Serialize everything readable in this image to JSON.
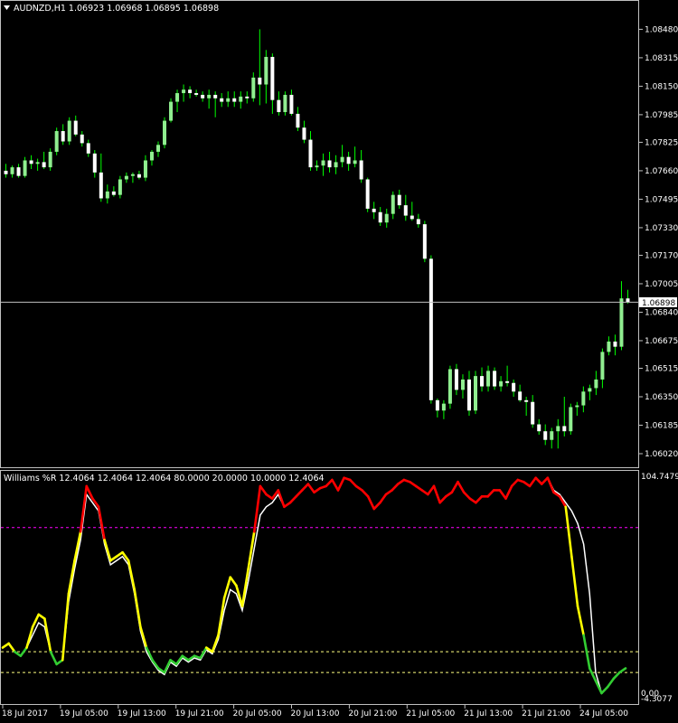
{
  "symbol_header": {
    "arrow_icon": "triangle-down-icon",
    "text": "AUDNZD,H1  1.06923 1.06968 1.06895 1.06898"
  },
  "indicator_header": {
    "text": "Williams %R 12.4064 12.4064 12.4064 80.0000 20.0000 10.0000 12.4064"
  },
  "colors": {
    "background": "#000000",
    "bull_candle": "#90ee90",
    "bear_candle": "#ffffff",
    "wick": "#00ff00",
    "price_line": "#c0c0c0",
    "wpr_main": "#ffff00",
    "wpr_overbought": "#ff0000",
    "wpr_oversold": "#32cd32",
    "wpr_signal": "#ffffff",
    "level_80": "#ff00ff",
    "level_20": "#ffff80"
  },
  "current_price_label": "1.06898",
  "chart_data": [
    {
      "type": "candlestick",
      "title": "AUDNZD,H1",
      "ylim": [
        1.0602,
        1.08545
      ],
      "y_ticks": [
        "1.08480",
        "1.08315",
        "1.08150",
        "1.07985",
        "1.07825",
        "1.07660",
        "1.07495",
        "1.07330",
        "1.07170",
        "1.07005",
        "1.06840",
        "1.06675",
        "1.06515",
        "1.06350",
        "1.06185",
        "1.06020"
      ],
      "last_price": 1.06898,
      "ohlc": [
        [
          1.0766,
          1.077,
          1.0762,
          1.0764
        ],
        [
          1.0764,
          1.0769,
          1.0762,
          1.0768
        ],
        [
          1.0768,
          1.077,
          1.0762,
          1.0763
        ],
        [
          1.0763,
          1.0774,
          1.0762,
          1.0772
        ],
        [
          1.0772,
          1.0775,
          1.0767,
          1.077
        ],
        [
          1.077,
          1.0773,
          1.0766,
          1.0771
        ],
        [
          1.0771,
          1.0777,
          1.0767,
          1.0768
        ],
        [
          1.0768,
          1.0779,
          1.0766,
          1.0777
        ],
        [
          1.0777,
          1.0791,
          1.0775,
          1.0789
        ],
        [
          1.0789,
          1.0793,
          1.0781,
          1.0783
        ],
        [
          1.0783,
          1.0797,
          1.0781,
          1.0795
        ],
        [
          1.0795,
          1.0798,
          1.0786,
          1.0787
        ],
        [
          1.0787,
          1.0789,
          1.078,
          1.0782
        ],
        [
          1.0782,
          1.0784,
          1.0774,
          1.0776
        ],
        [
          1.0776,
          1.0778,
          1.0762,
          1.0765
        ],
        [
          1.0765,
          1.0776,
          1.0748,
          1.075
        ],
        [
          1.075,
          1.0758,
          1.0747,
          1.0754
        ],
        [
          1.0754,
          1.0757,
          1.0751,
          1.0752
        ],
        [
          1.0752,
          1.0763,
          1.075,
          1.0761
        ],
        [
          1.0761,
          1.0765,
          1.0759,
          1.0763
        ],
        [
          1.0763,
          1.0765,
          1.0759,
          1.0764
        ],
        [
          1.0764,
          1.0766,
          1.0761,
          1.0762
        ],
        [
          1.0762,
          1.0775,
          1.076,
          1.0772
        ],
        [
          1.0772,
          1.0778,
          1.0769,
          1.0777
        ],
        [
          1.0777,
          1.0783,
          1.0774,
          1.0781
        ],
        [
          1.0781,
          1.0797,
          1.0779,
          1.0795
        ],
        [
          1.0795,
          1.0808,
          1.0794,
          1.0806
        ],
        [
          1.0806,
          1.0813,
          1.08,
          1.0811
        ],
        [
          1.0811,
          1.0816,
          1.0806,
          1.0813
        ],
        [
          1.0813,
          1.0815,
          1.0808,
          1.0811
        ],
        [
          1.0811,
          1.0813,
          1.0809,
          1.081
        ],
        [
          1.081,
          1.0812,
          1.0806,
          1.0808
        ],
        [
          1.0808,
          1.0813,
          1.0802,
          1.081
        ],
        [
          1.081,
          1.0812,
          1.0797,
          1.0808
        ],
        [
          1.0808,
          1.0811,
          1.0803,
          1.0806
        ],
        [
          1.0806,
          1.0812,
          1.0803,
          1.0808
        ],
        [
          1.0808,
          1.0812,
          1.0803,
          1.0806
        ],
        [
          1.0806,
          1.0812,
          1.0802,
          1.0809
        ],
        [
          1.0809,
          1.0812,
          1.0805,
          1.0808
        ],
        [
          1.0808,
          1.0823,
          1.0806,
          1.082
        ],
        [
          1.082,
          1.0848,
          1.0804,
          1.0816
        ],
        [
          1.0816,
          1.0836,
          1.0805,
          1.0832
        ],
        [
          1.0832,
          1.0834,
          1.0799,
          1.0807
        ],
        [
          1.0807,
          1.0812,
          1.0798,
          1.08
        ],
        [
          1.08,
          1.0812,
          1.0798,
          1.081
        ],
        [
          1.081,
          1.0813,
          1.0798,
          1.0799
        ],
        [
          1.0799,
          1.0803,
          1.0789,
          1.0791
        ],
        [
          1.0791,
          1.0795,
          1.0782,
          1.0784
        ],
        [
          1.0784,
          1.0789,
          1.0766,
          1.0768
        ],
        [
          1.0768,
          1.0772,
          1.0766,
          1.0769
        ],
        [
          1.0769,
          1.0776,
          1.0763,
          1.0772
        ],
        [
          1.0772,
          1.0777,
          1.0765,
          1.0768
        ],
        [
          1.0768,
          1.0775,
          1.0764,
          1.0771
        ],
        [
          1.0771,
          1.0781,
          1.0768,
          1.0774
        ],
        [
          1.0774,
          1.0777,
          1.0766,
          1.077
        ],
        [
          1.077,
          1.078,
          1.0768,
          1.0772
        ],
        [
          1.0772,
          1.0778,
          1.0759,
          1.0761
        ],
        [
          1.0761,
          1.0762,
          1.0742,
          1.0744
        ],
        [
          1.0744,
          1.0748,
          1.0738,
          1.0742
        ],
        [
          1.0742,
          1.0745,
          1.0734,
          1.0736
        ],
        [
          1.0736,
          1.0744,
          1.0733,
          1.0741
        ],
        [
          1.0741,
          1.0754,
          1.0738,
          1.0752
        ],
        [
          1.0752,
          1.0755,
          1.0744,
          1.0746
        ],
        [
          1.0746,
          1.0752,
          1.0737,
          1.074
        ],
        [
          1.074,
          1.0748,
          1.0737,
          1.0738
        ],
        [
          1.0738,
          1.0741,
          1.0733,
          1.0735
        ],
        [
          1.0735,
          1.0737,
          1.0713,
          1.0715
        ],
        [
          1.0715,
          1.0717,
          1.0631,
          1.0633
        ],
        [
          1.0633,
          1.0634,
          1.0623,
          1.0627
        ],
        [
          1.0627,
          1.0633,
          1.0622,
          1.0631
        ],
        [
          1.0631,
          1.0653,
          1.0628,
          1.0651
        ],
        [
          1.0651,
          1.0654,
          1.0636,
          1.0639
        ],
        [
          1.0639,
          1.0648,
          1.0634,
          1.0645
        ],
        [
          1.0645,
          1.065,
          1.0624,
          1.0627
        ],
        [
          1.0627,
          1.065,
          1.0625,
          1.0647
        ],
        [
          1.0647,
          1.0652,
          1.0638,
          1.0641
        ],
        [
          1.0641,
          1.0653,
          1.0638,
          1.065
        ],
        [
          1.065,
          1.0652,
          1.0639,
          1.0641
        ],
        [
          1.0641,
          1.0647,
          1.0638,
          1.0644
        ],
        [
          1.0644,
          1.0653,
          1.0641,
          1.0643
        ],
        [
          1.0643,
          1.0645,
          1.0635,
          1.0638
        ],
        [
          1.0638,
          1.0642,
          1.0632,
          1.0633
        ],
        [
          1.0633,
          1.0635,
          1.0624,
          1.0632
        ],
        [
          1.0632,
          1.0636,
          1.0617,
          1.0619
        ],
        [
          1.0619,
          1.0622,
          1.0613,
          1.0615
        ],
        [
          1.0615,
          1.0619,
          1.0607,
          1.061
        ],
        [
          1.061,
          1.0617,
          1.0605,
          1.0615
        ],
        [
          1.0615,
          1.0622,
          1.0605,
          1.0618
        ],
        [
          1.0618,
          1.0635,
          1.0612,
          1.0615
        ],
        [
          1.0615,
          1.0631,
          1.0613,
          1.0629
        ],
        [
          1.0629,
          1.0632,
          1.0624,
          1.063
        ],
        [
          1.063,
          1.0641,
          1.0626,
          1.0638
        ],
        [
          1.0638,
          1.0642,
          1.0633,
          1.064
        ],
        [
          1.064,
          1.065,
          1.0636,
          1.0645
        ],
        [
          1.0645,
          1.0663,
          1.064,
          1.0661
        ],
        [
          1.0661,
          1.067,
          1.0659,
          1.0667
        ],
        [
          1.0667,
          1.0671,
          1.0659,
          1.0664
        ],
        [
          1.0664,
          1.0702,
          1.0662,
          1.0692
        ],
        [
          1.0692,
          1.0697,
          1.0689,
          1.069
        ]
      ]
    },
    {
      "type": "line",
      "title": "Williams %R",
      "ylim": [
        0,
        104.7479
      ],
      "y_ticks": [
        "104.7479",
        "0.00",
        "-4.3077"
      ],
      "levels": [
        80,
        20,
        10
      ],
      "x_tick_labels": [
        "18 Jul 2017",
        "19 Jul 05:00",
        "19 Jul 13:00",
        "19 Jul 21:00",
        "20 Jul 05:00",
        "20 Jul 13:00",
        "20 Jul 21:00",
        "21 Jul 05:00",
        "21 Jul 13:00",
        "21 Jul 21:00",
        "24 Jul 05:00"
      ],
      "series": [
        {
          "values": [
            22,
            24,
            20,
            18,
            22,
            32,
            38,
            36,
            20,
            14,
            16,
            48,
            64,
            78,
            100,
            94,
            90,
            74,
            64,
            66,
            68,
            64,
            50,
            32,
            22,
            16,
            12,
            10,
            16,
            14,
            18,
            16,
            18,
            17,
            22,
            20,
            28,
            46,
            56,
            52,
            42,
            60,
            78,
            100,
            96,
            94,
            98,
            90,
            92,
            95,
            98,
            101,
            97,
            99,
            100,
            103,
            98,
            104,
            103,
            100,
            98,
            95,
            89,
            92,
            96,
            98,
            101,
            103,
            102,
            100,
            98,
            96,
            100,
            92,
            95,
            97,
            102,
            97,
            94,
            92,
            95,
            95,
            98,
            98,
            94,
            100,
            103,
            102,
            100,
            104,
            101,
            104,
            97,
            95,
            90,
            66,
            42,
            28,
            12,
            6,
            0,
            3,
            7,
            10,
            12
          ]
        },
        {
          "values": [
            22,
            24,
            20,
            18,
            22,
            28,
            34,
            32,
            20,
            14,
            16,
            44,
            60,
            74,
            96,
            92,
            88,
            72,
            62,
            64,
            66,
            62,
            48,
            30,
            20,
            15,
            11,
            9,
            15,
            13,
            17,
            15,
            17,
            16,
            21,
            19,
            26,
            40,
            50,
            48,
            40,
            54,
            70,
            86,
            90,
            92,
            96,
            90,
            92,
            95,
            98,
            101,
            97,
            99,
            100,
            103,
            98,
            104,
            103,
            100,
            98,
            95,
            89,
            92,
            96,
            98,
            101,
            103,
            102,
            100,
            98,
            96,
            100,
            92,
            95,
            97,
            102,
            97,
            94,
            92,
            95,
            95,
            98,
            98,
            94,
            100,
            103,
            102,
            100,
            104,
            101,
            104,
            98,
            96,
            92,
            88,
            82,
            72,
            48,
            10,
            0,
            3,
            7,
            10,
            12
          ]
        }
      ]
    }
  ]
}
